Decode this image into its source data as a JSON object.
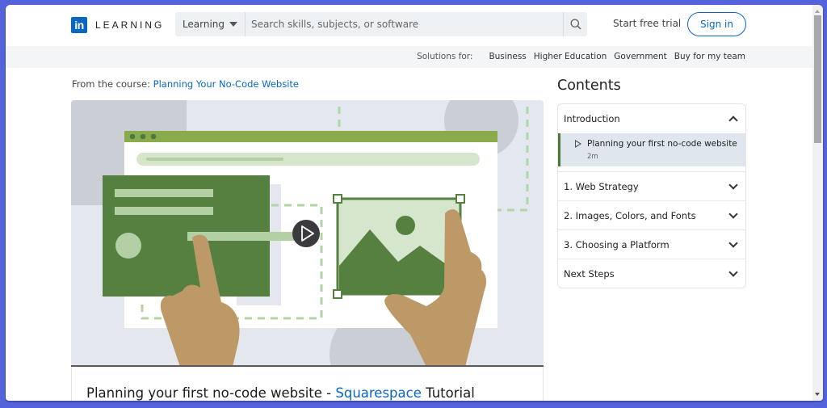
{
  "header": {
    "logo_mark": "in",
    "logo_text": "LEARNING",
    "search_category": "Learning",
    "search_placeholder": "Search skills, subjects, or software",
    "search_icon": "search-icon",
    "start_trial": "Start free trial",
    "sign_in": "Sign in"
  },
  "subnav": {
    "label": "Solutions for:",
    "links": [
      "Business",
      "Higher Education",
      "Government",
      "Buy for my team"
    ]
  },
  "course": {
    "from_label": "From the course:",
    "course_name": "Planning Your No-Code Website",
    "video_title_prefix": "Planning your first no-code website - ",
    "video_title_highlight": "Squarespace",
    "video_title_suffix": " Tutorial",
    "play_icon": "play-icon"
  },
  "contents": {
    "title": "Contents",
    "sections": [
      {
        "label": "Introduction",
        "expanded": true,
        "items": [
          {
            "title": "Planning your first no-code website",
            "duration": "2m",
            "active": true
          }
        ]
      },
      {
        "label": "1. Web Strategy",
        "expanded": false
      },
      {
        "label": "2. Images, Colors, and Fonts",
        "expanded": false
      },
      {
        "label": "3. Choosing a Platform",
        "expanded": false
      },
      {
        "label": "Next Steps",
        "expanded": false
      }
    ]
  },
  "colors": {
    "brand_blue": "#0a66c2",
    "accent_green": "#4b7a3a",
    "frame_purple": "#5462dc"
  }
}
